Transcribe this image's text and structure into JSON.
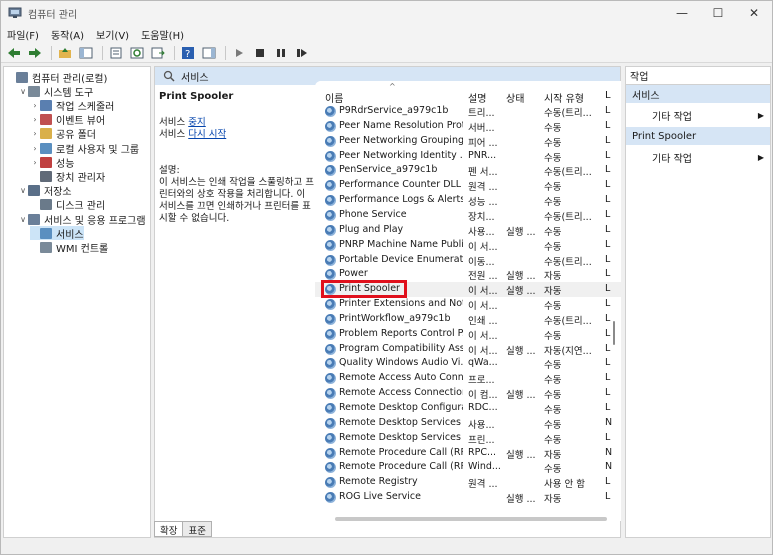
{
  "window": {
    "title": "컴퓨터 관리",
    "controls": [
      "—",
      "☐",
      "✕"
    ]
  },
  "menu": [
    "파일(F)",
    "동작(A)",
    "보기(V)",
    "도움말(H)"
  ],
  "tree": [
    {
      "label": "컴퓨터 관리(로컬)",
      "indent": 0,
      "exp": "",
      "color": "#6a7f99"
    },
    {
      "label": "시스템 도구",
      "indent": 1,
      "exp": "∨",
      "color": "#7a8a99"
    },
    {
      "label": "작업 스케줄러",
      "indent": 2,
      "exp": "›",
      "color": "#5a7fb0"
    },
    {
      "label": "이벤트 뷰어",
      "indent": 2,
      "exp": "›",
      "color": "#c05050"
    },
    {
      "label": "공유 폴더",
      "indent": 2,
      "exp": "›",
      "color": "#d9b04a"
    },
    {
      "label": "로컬 사용자 및 그룹",
      "indent": 2,
      "exp": "›",
      "color": "#5a8fc0"
    },
    {
      "label": "성능",
      "indent": 2,
      "exp": "›",
      "color": "#c04040"
    },
    {
      "label": "장치 관리자",
      "indent": 2,
      "exp": "",
      "color": "#606a78"
    },
    {
      "label": "저장소",
      "indent": 1,
      "exp": "∨",
      "color": "#5a6f88"
    },
    {
      "label": "디스크 관리",
      "indent": 2,
      "exp": "",
      "color": "#6a7a8a"
    },
    {
      "label": "서비스 및 응용 프로그램",
      "indent": 1,
      "exp": "∨",
      "color": "#6a7f99"
    },
    {
      "label": "서비스",
      "indent": 2,
      "exp": "",
      "color": "#5a8fc0",
      "selected": true
    },
    {
      "label": "WMI 컨트롤",
      "indent": 2,
      "exp": "",
      "color": "#7a8a99"
    }
  ],
  "middle": {
    "header": "서비스",
    "selected_service": "Print Spooler",
    "action_stop_prefix": "서비스 ",
    "action_stop_link": "중지",
    "action_restart_prefix": "서비스 ",
    "action_restart_link": "다시 시작",
    "description_label": "설명:",
    "description": "이 서비스는 인쇄 작업을 스풀링하고 프린터와의 상호 작용을 처리합니다. 이 서비스를 끄면 인쇄하거나 프린터를 표시할 수 없습니다."
  },
  "columns": [
    "이름",
    "설명",
    "상태",
    "시작 유형",
    "L"
  ],
  "services": [
    [
      "P9RdrService_a979c1b",
      "트리...",
      "",
      "수동(트리...",
      "L"
    ],
    [
      "Peer Name Resolution Prot...",
      "서버...",
      "",
      "수동",
      "L"
    ],
    [
      "Peer Networking Grouping",
      "피어 ...",
      "",
      "수동",
      "L"
    ],
    [
      "Peer Networking Identity ...",
      "PNR...",
      "",
      "수동",
      "L"
    ],
    [
      "PenService_a979c1b",
      "펜 서...",
      "",
      "수동(트리...",
      "L"
    ],
    [
      "Performance Counter DLL ...",
      "원격 ...",
      "",
      "수동",
      "L"
    ],
    [
      "Performance Logs & Alerts",
      "성능 ...",
      "",
      "수동",
      "L"
    ],
    [
      "Phone Service",
      "장치...",
      "",
      "수동(트리...",
      "L"
    ],
    [
      "Plug and Play",
      "사용...",
      "실행 ...",
      "수동",
      "L"
    ],
    [
      "PNRP Machine Name Publi...",
      "이 서...",
      "",
      "수동",
      "L"
    ],
    [
      "Portable Device Enumerato...",
      "이동...",
      "",
      "수동(트리...",
      "L"
    ],
    [
      "Power",
      "전원 ...",
      "실행 ...",
      "자동",
      "L"
    ],
    [
      "Print Spooler",
      "이 서...",
      "실행 ...",
      "자동",
      "L"
    ],
    [
      "Printer Extensions and Noti...",
      "이 서...",
      "",
      "수동",
      "L"
    ],
    [
      "PrintWorkflow_a979c1b",
      "인쇄 ...",
      "",
      "수동(트리...",
      "L"
    ],
    [
      "Problem Reports Control P...",
      "이 서...",
      "",
      "수동",
      "L"
    ],
    [
      "Program Compatibility Assi...",
      "이 서...",
      "실행 ...",
      "자동(지연...",
      "L"
    ],
    [
      "Quality Windows Audio Vi...",
      "qWa...",
      "",
      "수동",
      "L"
    ],
    [
      "Remote Access Auto Conn...",
      "프로...",
      "",
      "수동",
      "L"
    ],
    [
      "Remote Access Connection...",
      "이 컴...",
      "실행 ...",
      "수동",
      "L"
    ],
    [
      "Remote Desktop Configura...",
      "RDC...",
      "",
      "수동",
      "L"
    ],
    [
      "Remote Desktop Services",
      "사용...",
      "",
      "수동",
      "N"
    ],
    [
      "Remote Desktop Services ...",
      "프린...",
      "",
      "수동",
      "L"
    ],
    [
      "Remote Procedure Call (RP...",
      "RPC...",
      "실행 ...",
      "자동",
      "N"
    ],
    [
      "Remote Procedure Call (RP...",
      "Wind...",
      "",
      "수동",
      "N"
    ],
    [
      "Remote Registry",
      "원격 ...",
      "",
      "사용 안 함",
      "L"
    ],
    [
      "ROG Live Service",
      "",
      "실행 ...",
      "자동",
      "L"
    ]
  ],
  "highlighted_index": 12,
  "tabs": [
    "확장",
    "표준"
  ],
  "actions": {
    "title": "작업",
    "sections": [
      {
        "header": "서비스",
        "item": "기타 작업"
      },
      {
        "header": "Print Spooler",
        "item": "기타 작업"
      }
    ]
  }
}
